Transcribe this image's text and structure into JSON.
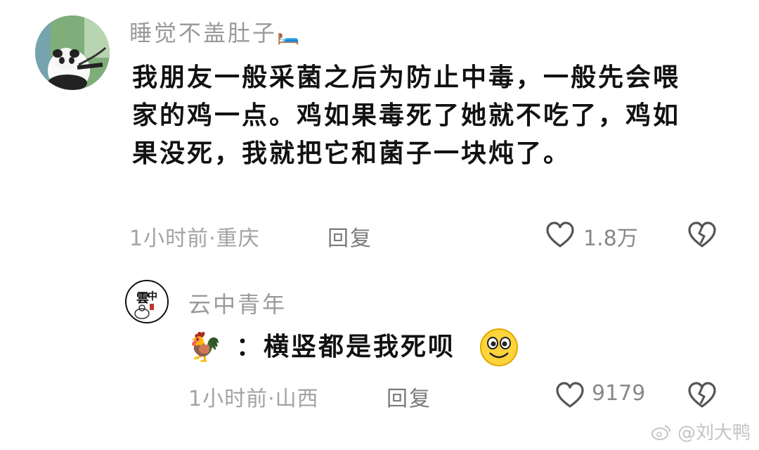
{
  "comment": {
    "username": "睡觉不盖肚子",
    "username_emoji": "🛏️",
    "text": "我朋友一般采菌之后为防止中毒，一般先会喂家的鸡一点。鸡如果毒死了她就不吃了，鸡如果没死，我就把它和菌子一块炖了。",
    "time": "1小时前",
    "location": "·重庆",
    "reply_label": "回复",
    "like_count": "1.8万",
    "icons": {
      "like": "heart-outline-icon",
      "dislike": "broken-heart-icon"
    }
  },
  "reply": {
    "username": "云中青年",
    "avatar_text": "雲中",
    "prefix_emoji": "🐓",
    "text": "：横竖都是我死呗",
    "suffix_emoji": "😊",
    "time": "1小时前",
    "location": "·山西",
    "reply_label": "回复",
    "like_count": "9179",
    "icons": {
      "like": "heart-outline-icon",
      "dislike": "broken-heart-icon"
    }
  },
  "watermark": "@刘大鸭"
}
